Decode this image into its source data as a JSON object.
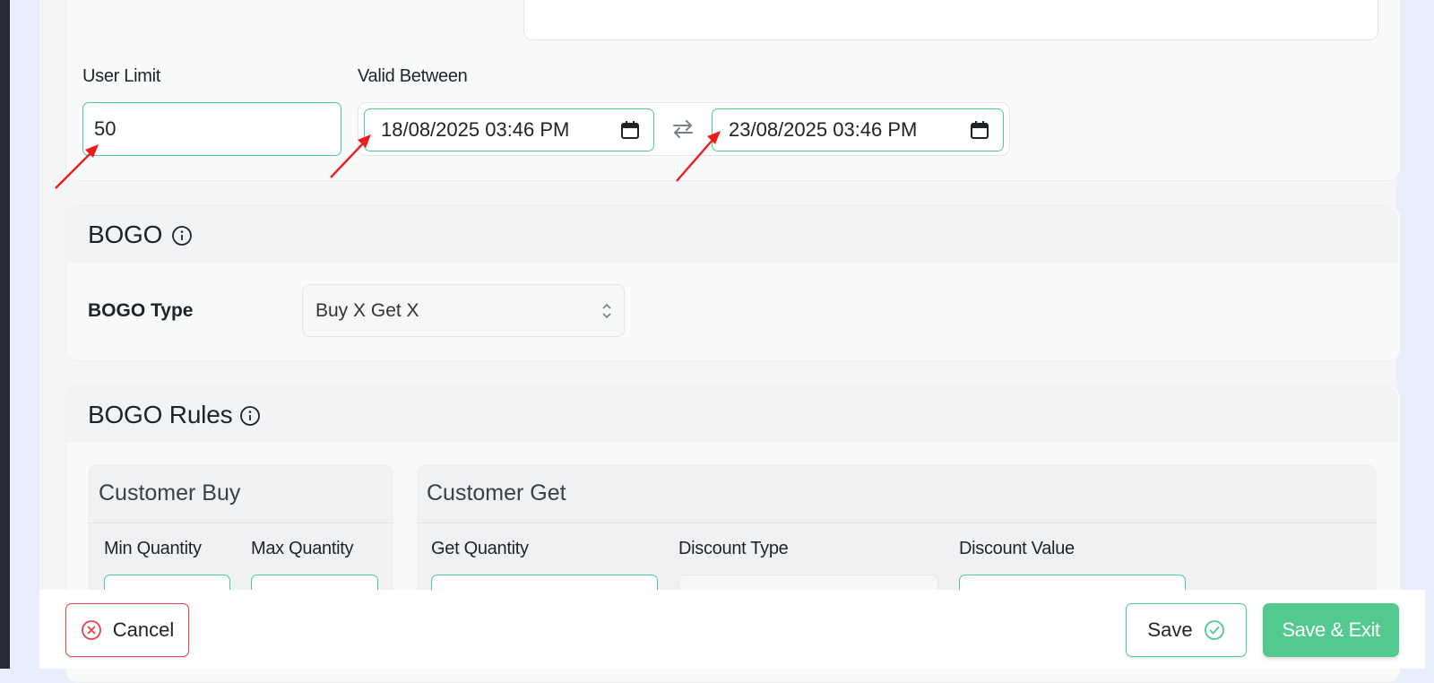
{
  "form": {
    "user_limit_label": "User Limit",
    "user_limit_value": "50",
    "valid_between_label": "Valid Between",
    "start_datetime": "18/08/2025 03:46 PM",
    "end_datetime": "23/08/2025 03:46 PM"
  },
  "bogo": {
    "title": "BOGO",
    "type_label": "BOGO Type",
    "type_value": "Buy X Get X"
  },
  "bogo_rules": {
    "title": "BOGO Rules",
    "customer_buy": {
      "title": "Customer Buy",
      "min_label": "Min Quantity",
      "max_label": "Max Quantity"
    },
    "customer_get": {
      "title": "Customer Get",
      "get_qty_label": "Get Quantity",
      "discount_type_label": "Discount Type",
      "discount_value_label": "Discount Value"
    }
  },
  "footer": {
    "cancel_label": "Cancel",
    "save_label": "Save",
    "save_exit_label": "Save & Exit"
  },
  "colors": {
    "accent": "#4fc98e",
    "cancel": "#e0444e",
    "annotation_arrow": "#ee1c1c"
  },
  "icons": [
    "calendar-icon",
    "swap-icon",
    "info-icon",
    "chevron-updown-icon",
    "x-circle-icon",
    "check-circle-icon",
    "annotation-arrow"
  ]
}
